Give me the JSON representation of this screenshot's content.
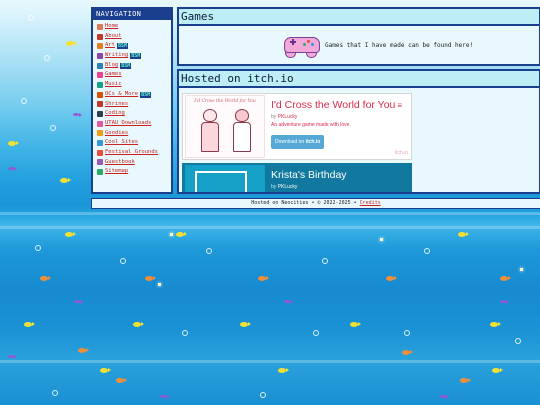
{
  "nav": {
    "heading": "NAVIGATION",
    "items": [
      {
        "label": "Home",
        "icon": "home-icon",
        "icon_color": "#e07a5a",
        "badge": ""
      },
      {
        "label": "About",
        "icon": "about-icon",
        "icon_color": "#c0392b",
        "badge": ""
      },
      {
        "label": "Art",
        "icon": "art-icon",
        "icon_color": "#e67e22",
        "badge": "BSM"
      },
      {
        "label": "Writing",
        "icon": "writing-icon",
        "icon_color": "#8e44ad",
        "badge": "BSM"
      },
      {
        "label": "Blog",
        "icon": "blog-icon",
        "icon_color": "#2980b9",
        "badge": "BSM"
      },
      {
        "label": "Games",
        "icon": "games-icon",
        "icon_color": "#e84393",
        "badge": ""
      },
      {
        "label": "Music",
        "icon": "music-icon",
        "icon_color": "#16a085",
        "badge": ""
      },
      {
        "label": "OCs & More",
        "icon": "ocs-icon",
        "icon_color": "#d35400",
        "badge": "BSM"
      },
      {
        "label": "Shrines",
        "icon": "shrines-icon",
        "icon_color": "#c0392b",
        "badge": ""
      },
      {
        "label": "Coding",
        "icon": "coding-icon",
        "icon_color": "#2c3e50",
        "badge": ""
      },
      {
        "label": "UTAU Downloads",
        "icon": "utau-icon",
        "icon_color": "#e056a0",
        "badge": ""
      },
      {
        "label": "Goodies",
        "icon": "goodies-icon",
        "icon_color": "#f39c12",
        "badge": ""
      },
      {
        "label": "Cool Sites",
        "icon": "cool-sites-icon",
        "icon_color": "#3498db",
        "badge": ""
      },
      {
        "label": "Festival Grounds",
        "icon": "festival-icon",
        "icon_color": "#e74c3c",
        "badge": ""
      },
      {
        "label": "Guestbook",
        "icon": "guestbook-icon",
        "icon_color": "#9b59b6",
        "badge": ""
      },
      {
        "label": "Sitemap",
        "icon": "sitemap-icon",
        "icon_color": "#27ae60",
        "badge": ""
      }
    ]
  },
  "games": {
    "title": "Games",
    "description": "Games that I have made can be found here!",
    "icon": "game-controller-icon"
  },
  "itch": {
    "title": "Hosted on itch.io",
    "widgets": [
      {
        "cover_title": "I'd Cross the World for You",
        "title": "I'd Cross the World for You",
        "menu_icon": "≡",
        "by_prefix": "by",
        "author": "PKLucky",
        "description": "An adventure game made with love",
        "button_prefix": "Download on",
        "button_brand": "itch.io",
        "logo": "itch.io"
      },
      {
        "title": "Krista's Birthday",
        "by_prefix": "by",
        "author": "PKLucky"
      }
    ]
  },
  "footer": {
    "text": "Hosted on Neocities • © 2022-2025 •",
    "credits": "Credits"
  },
  "colors": {
    "panel_border": "#1a3f8f",
    "title_bar": "#bdeef6",
    "link": "#cc2222",
    "itch_red": "#da2c4a",
    "itch_dark": "#11799f"
  }
}
